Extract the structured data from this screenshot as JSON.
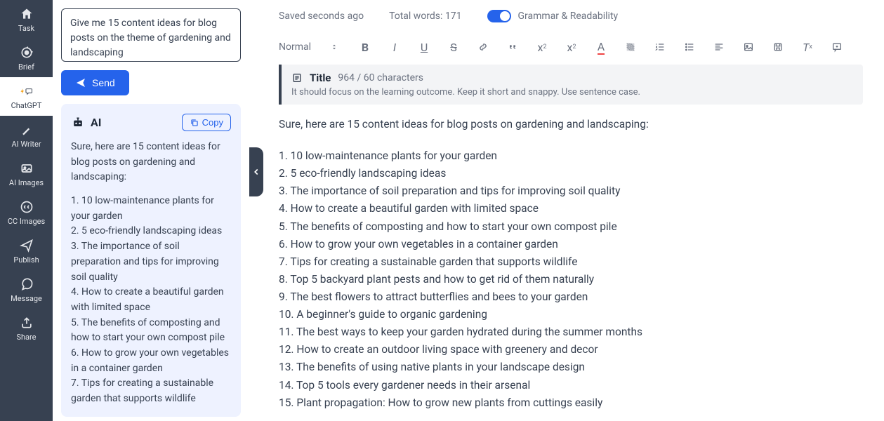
{
  "sidebar": {
    "items": [
      {
        "label": "Task"
      },
      {
        "label": "Brief"
      },
      {
        "label": "ChatGPT"
      },
      {
        "label": "AI Writer"
      },
      {
        "label": "AI Images"
      },
      {
        "label": "CC Images"
      },
      {
        "label": "Publish"
      },
      {
        "label": "Message"
      },
      {
        "label": "Share"
      }
    ]
  },
  "prompt": "Give me 15 content ideas for blog posts on the theme of gardening and landscaping",
  "send_label": "Send",
  "ai_panel": {
    "title": "AI",
    "copy_label": "Copy",
    "intro": "Sure, here are 15 content ideas for blog posts on gardening and landscaping:",
    "items": [
      "1. 10 low-maintenance plants for your garden",
      "2. 5 eco-friendly landscaping ideas",
      "3. The importance of soil preparation and tips for improving soil quality",
      "4. How to create a beautiful garden with limited space",
      "5. The benefits of composting and how to start your own compost pile",
      "6. How to grow your own vegetables in a container garden",
      "7. Tips for creating a sustainable garden that supports wildlife"
    ]
  },
  "header": {
    "saved": "Saved seconds ago",
    "words": "Total words: 171",
    "toggle_label": "Grammar & Readability"
  },
  "toolbar": {
    "format": "Normal"
  },
  "title_box": {
    "label": "Title",
    "counter": "964 / 60 characters",
    "hint": "It should focus on the learning outcome. Keep it short and snappy. Use sentence case."
  },
  "doc": {
    "intro": "Sure, here are 15 content ideas for blog posts on gardening and landscaping:",
    "items": [
      "1. 10 low-maintenance plants for your garden",
      "2. 5 eco-friendly landscaping ideas",
      "3. The importance of soil preparation and tips for improving soil quality",
      "4. How to create a beautiful garden with limited space",
      "5. The benefits of composting and how to start your own compost pile",
      "6. How to grow your own vegetables in a container garden",
      "7. Tips for creating a sustainable garden that supports wildlife",
      "8. Top 5 backyard plant pests and how to get rid of them naturally",
      "9. The best flowers to attract butterflies and bees to your garden",
      "10. A beginner's guide to organic gardening",
      "11. The best ways to keep your garden hydrated during the summer months",
      "12. How to create an outdoor living space with greenery and decor",
      "13. The benefits of using native plants in your landscape design",
      "14. Top 5 tools every gardener needs in their arsenal",
      "15. Plant propagation: How to grow new plants from cuttings easily"
    ]
  }
}
